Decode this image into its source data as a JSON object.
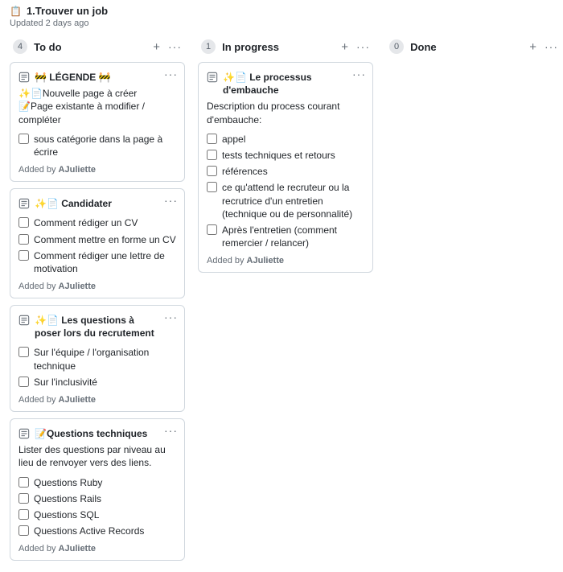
{
  "header": {
    "icon": "📋",
    "title": "1.Trouver un job",
    "updated": "Updated 2 days ago"
  },
  "addedByPrefix": "Added by ",
  "columns": [
    {
      "count": "4",
      "title": "To do",
      "cards": [
        {
          "title": "🚧 LÉGENDE 🚧",
          "descLines": [
            "✨📄Nouvelle page à créer",
            "📝Page existante à modifier / compléter"
          ],
          "checks": [
            "sous catégorie dans la page à écrire"
          ],
          "author": "AJuliette"
        },
        {
          "title": "✨📄 Candidater",
          "descLines": [],
          "checks": [
            "Comment rédiger un CV",
            "Comment mettre en forme un CV",
            "Comment rédiger une lettre de motivation"
          ],
          "author": "AJuliette"
        },
        {
          "title": "✨📄 Les questions à poser lors du recrutement",
          "descLines": [],
          "checks": [
            "Sur l'équipe / l'organisation technique",
            "Sur l'inclusivité"
          ],
          "author": "AJuliette"
        },
        {
          "title": "📝Questions techniques",
          "descLines": [
            "Lister des questions par niveau au lieu de renvoyer vers des liens."
          ],
          "checks": [
            "Questions Ruby",
            "Questions Rails",
            "Questions SQL",
            "Questions Active Records"
          ],
          "author": "AJuliette"
        }
      ]
    },
    {
      "count": "1",
      "title": "In progress",
      "cards": [
        {
          "title": "✨📄 Le processus d'embauche",
          "descLines": [
            "Description du process courant d'embauche:"
          ],
          "checks": [
            "appel",
            "tests techniques et retours",
            "références",
            "ce qu'attend le recruteur ou la recrutrice d'un entretien (technique ou de personnalité)",
            "Après l'entretien (comment remercier / relancer)"
          ],
          "author": "AJuliette"
        }
      ]
    },
    {
      "count": "0",
      "title": "Done",
      "cards": []
    }
  ]
}
